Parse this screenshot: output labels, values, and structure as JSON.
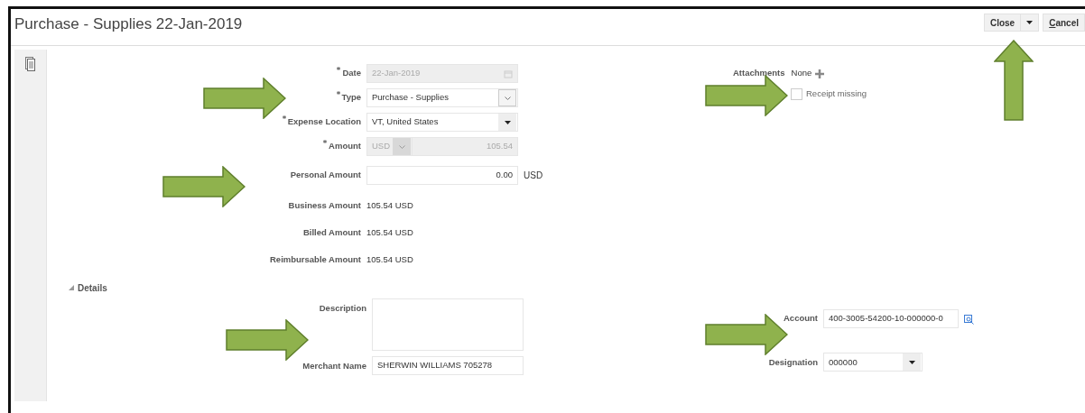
{
  "title": "Purchase - Supplies 22-Jan-2019",
  "header_buttons": [
    {
      "label": "Close",
      "kind": "split"
    },
    {
      "label": "Cancel",
      "kind": "plain"
    }
  ],
  "fields": [
    {
      "label": "Date",
      "required": true,
      "kind": "date",
      "value": "22-Jan-2019",
      "disabled": true
    },
    {
      "label": "Type",
      "required": true,
      "kind": "select",
      "value": "Purchase - Supplies",
      "disabled": false
    },
    {
      "label": "Expense Location",
      "required": true,
      "kind": "dropdown",
      "value": "VT, United States",
      "disabled": false
    },
    {
      "label": "Amount",
      "required": true,
      "kind": "amount",
      "currency": "USD",
      "value": "105.54",
      "disabled": true
    },
    {
      "label": "Personal Amount",
      "required": false,
      "kind": "input",
      "value": "0.00",
      "unit": "USD",
      "disabled": false
    },
    {
      "label": "Business Amount",
      "required": false,
      "kind": "text",
      "value": "105.54 USD",
      "disabled": false
    },
    {
      "label": "Billed Amount",
      "required": false,
      "kind": "text",
      "value": "105.54 USD",
      "disabled": false
    },
    {
      "label": "Reimbursable Amount",
      "required": false,
      "kind": "text",
      "value": "105.54 USD",
      "disabled": false
    }
  ],
  "attachments": {
    "label": "Attachments",
    "value": "None"
  },
  "receipt_missing": {
    "label": "Receipt missing",
    "checked": false
  },
  "details": {
    "label": "Details",
    "expanded": true,
    "fields": [
      {
        "label": "Description",
        "kind": "textarea"
      },
      {
        "label": "Merchant Name",
        "kind": "input",
        "value": "SHERWIN WILLIAMS 705278"
      }
    ],
    "side_fields": [
      {
        "label": "Account",
        "kind": "lookup",
        "value": "400-3005-54200-10-000000-0"
      },
      {
        "label": "Designation",
        "kind": "dropdown",
        "value": "000000"
      }
    ]
  }
}
